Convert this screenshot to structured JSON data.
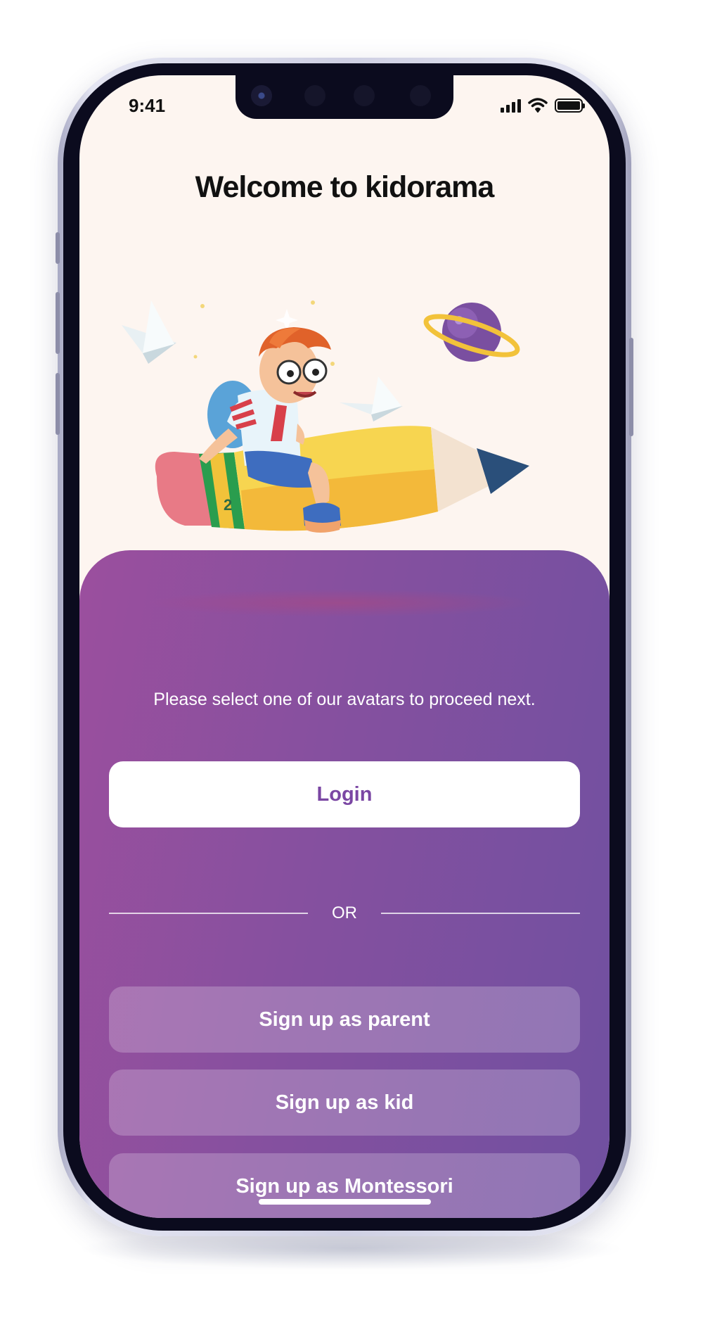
{
  "status_bar": {
    "time": "9:41",
    "icons": [
      "signal-icon",
      "wifi-icon",
      "battery-icon"
    ]
  },
  "header": {
    "title": "Welcome to kidorama"
  },
  "illustration": {
    "pencil_label": "2"
  },
  "main": {
    "instruction": "Please select one of our avatars to proceed next.",
    "login_label": "Login",
    "divider_label": "OR",
    "signup_buttons": [
      {
        "label": "Sign up as parent"
      },
      {
        "label": "Sign up as kid"
      },
      {
        "label": "Sign up as Montessori"
      }
    ]
  },
  "colors": {
    "background": "#fdf5f0",
    "panel_start": "#9b4f9e",
    "panel_end": "#7050a0",
    "login_text": "#7a46a3"
  }
}
